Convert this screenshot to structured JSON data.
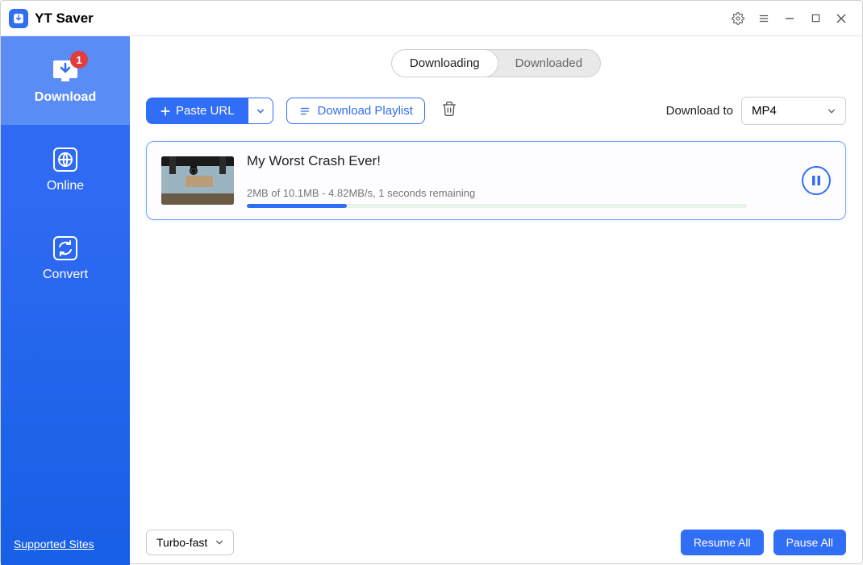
{
  "app": {
    "name": "YT Saver"
  },
  "sidebar": {
    "items": [
      {
        "label": "Download",
        "badge": "1"
      },
      {
        "label": "Online"
      },
      {
        "label": "Convert"
      }
    ],
    "supported_sites": "Supported Sites"
  },
  "tabs": {
    "downloading": "Downloading",
    "downloaded": "Downloaded"
  },
  "toolbar": {
    "paste_url": "Paste URL",
    "download_playlist": "Download Playlist",
    "download_to_label": "Download to",
    "format_selected": "MP4"
  },
  "download": {
    "title": "My Worst Crash Ever!",
    "stats": "2MB of 10.1MB -   4.82MB/s, 1 seconds remaining",
    "progress_pct": 20
  },
  "footer": {
    "speed_mode": "Turbo-fast",
    "resume_all": "Resume All",
    "pause_all": "Pause All"
  }
}
